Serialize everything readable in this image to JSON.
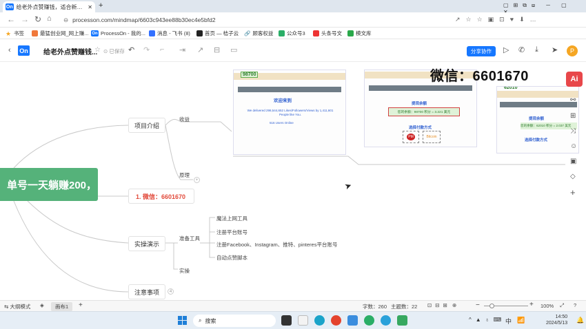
{
  "browser": {
    "tab_title": "给老外点赞赚钱，适合新手的副业",
    "url": "processon.com/mindmap/6603c943ee88b30ec4e5bfd2",
    "bookmarks": [
      "书签",
      "最猛创业网_网上赚...",
      "ProcessOn - 我的...",
      "消息 - 飞书 (8)",
      "首页 — 桔子云",
      "顾客权益",
      "公众号3",
      "头条号文",
      "模文库"
    ]
  },
  "app": {
    "doc_title": "给老外点赞赚钱...",
    "saved_status": "已保存",
    "share_label": "分享协作",
    "avatar_letter": "P"
  },
  "mindmap": {
    "root": "单号一天躺赚200，",
    "branches": {
      "intro": "项目介绍",
      "income": "收益",
      "principle": "原理",
      "wechat_node": "1. 微信：6601670",
      "demo": "实操演示",
      "prepare": "准备工具",
      "tools": [
        "魔法上网工具",
        "注册平台账号",
        "注册Facebook、Instagram、推特、pinteres平台账号",
        "自动点赞脚本"
      ],
      "practice": "实操",
      "notes": "注意事项"
    },
    "overlay_wechat": "微信：6601670",
    "shot1": {
      "badge": "98700",
      "welcome": "欢迎来到",
      "stats": "We delivered 298,544,652 Likes/Followers/Views by 1,411,601 People like You.",
      "online": "516 Users Online"
    },
    "shot2": {
      "title": "提现余额",
      "balance": "您的余额：98700 积分 = 3.221 美元",
      "pay_title": "选择付款方式",
      "pm1": "PM",
      "pm2": "Bitcoin"
    },
    "shot3": {
      "badge": "62010",
      "title": "提现余额",
      "balance": "您的余额：62010 积分 = 2.037 美元",
      "pay_title": "选择付款方式"
    }
  },
  "statusbar": {
    "outline": "大纲模式",
    "canvas_tab": "画布1",
    "word_count": "字数：260",
    "topic_count": "主题数：22",
    "zoom": "100%"
  },
  "taskbar": {
    "search_placeholder": "搜索",
    "ime": "中",
    "time": "14:50",
    "date": "2024/5/13"
  },
  "colors": {
    "root_green": "#55b27a",
    "accent_blue": "#1677ff",
    "wechat_red": "#e24a3b",
    "ai_red": "#e8474a"
  }
}
